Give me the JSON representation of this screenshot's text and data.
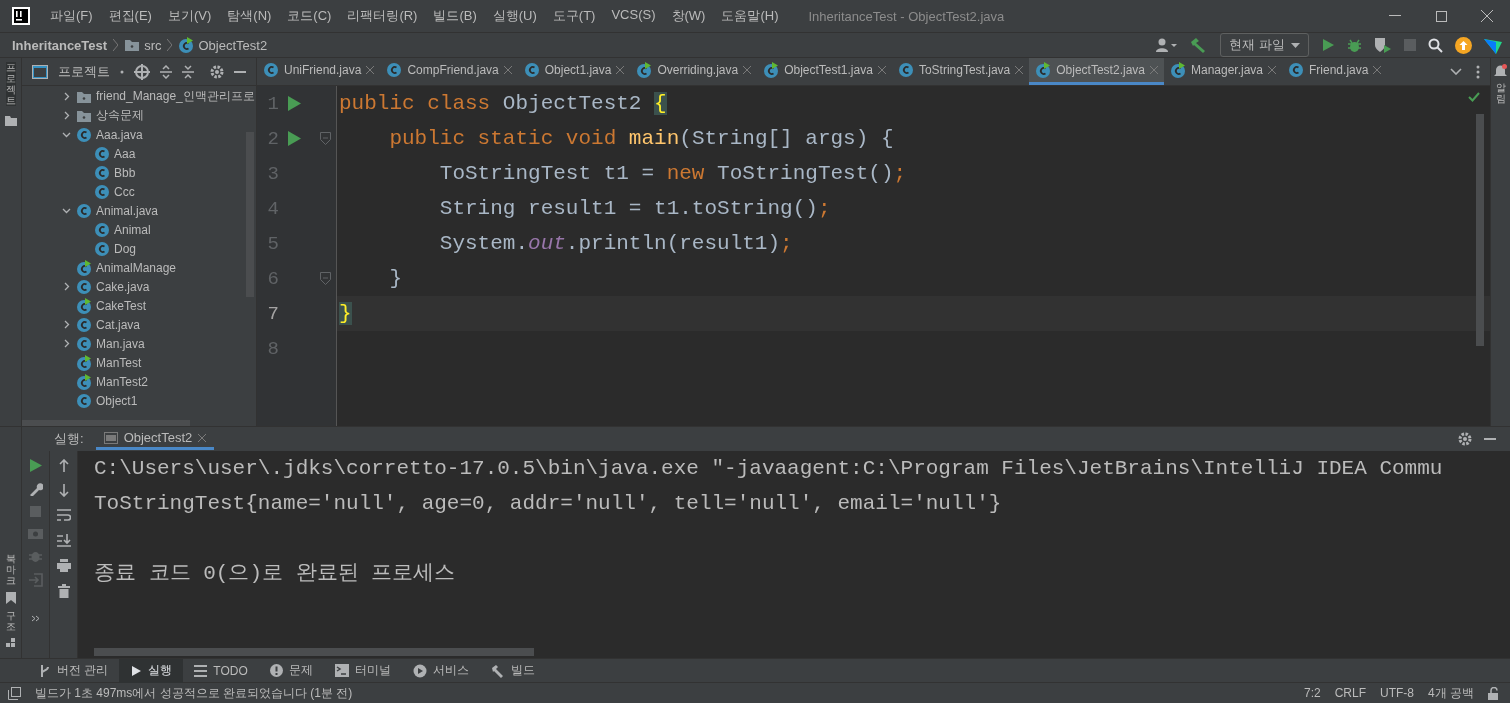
{
  "window": {
    "title": "InheritanceTest - ObjectTest2.java"
  },
  "menu": [
    "파일(F)",
    "편집(E)",
    "보기(V)",
    "탐색(N)",
    "코드(C)",
    "리팩터링(R)",
    "빌드(B)",
    "실행(U)",
    "도구(T)",
    "VCS(S)",
    "창(W)",
    "도움말(H)"
  ],
  "breadcrumbs": [
    {
      "label": "InheritanceTest",
      "kind": "project"
    },
    {
      "label": "src",
      "kind": "folder"
    },
    {
      "label": "ObjectTest2",
      "kind": "runnable"
    }
  ],
  "run_config": "현재 파일",
  "left_strip": [
    "프로젝트",
    "북마크",
    "구조"
  ],
  "right_strip": [
    "알림"
  ],
  "project_panel": {
    "title": "프로젝트",
    "tree": [
      {
        "label": "friend_Manage_인맥관리프로",
        "kind": "folder",
        "expanded": false
      },
      {
        "label": "상속문제",
        "kind": "folder",
        "expanded": false
      },
      {
        "label": "Aaa.java",
        "kind": "class",
        "expanded": true,
        "children": [
          {
            "label": "Aaa",
            "kind": "class"
          },
          {
            "label": "Bbb",
            "kind": "class"
          },
          {
            "label": "Ccc",
            "kind": "class"
          }
        ]
      },
      {
        "label": "Animal.java",
        "kind": "class",
        "expanded": true,
        "children": [
          {
            "label": "Animal",
            "kind": "class"
          },
          {
            "label": "Dog",
            "kind": "class"
          }
        ]
      },
      {
        "label": "AnimalManage",
        "kind": "runnable"
      },
      {
        "label": "Cake.java",
        "kind": "class",
        "expanded": false
      },
      {
        "label": "CakeTest",
        "kind": "runnable"
      },
      {
        "label": "Cat.java",
        "kind": "class",
        "expanded": false
      },
      {
        "label": "Man.java",
        "kind": "class",
        "expanded": false
      },
      {
        "label": "ManTest",
        "kind": "runnable"
      },
      {
        "label": "ManTest2",
        "kind": "runnable"
      },
      {
        "label": "Object1",
        "kind": "class"
      }
    ]
  },
  "tabs": [
    {
      "label": "UniFriend.java",
      "kind": "class",
      "selected": false
    },
    {
      "label": "CompFriend.java",
      "kind": "class",
      "selected": false
    },
    {
      "label": "Object1.java",
      "kind": "class",
      "selected": false
    },
    {
      "label": "Overriding.java",
      "kind": "runnable",
      "selected": false
    },
    {
      "label": "ObjectTest1.java",
      "kind": "runnable",
      "selected": false
    },
    {
      "label": "ToStringTest.java",
      "kind": "class",
      "selected": false
    },
    {
      "label": "ObjectTest2.java",
      "kind": "runnable",
      "selected": true
    },
    {
      "label": "Manager.java",
      "kind": "runnable",
      "selected": false
    },
    {
      "label": "Friend.java",
      "kind": "class",
      "selected": false
    }
  ],
  "code": [
    {
      "number": "1",
      "run": true,
      "fold": false,
      "current": false,
      "tokens": [
        {
          "kind": "keyword",
          "text": "public class "
        },
        {
          "kind": "plain",
          "text": "ObjectTest2 "
        },
        {
          "kind": "brace_match",
          "text": "{"
        }
      ]
    },
    {
      "number": "2",
      "run": true,
      "fold": true,
      "current": false,
      "tokens": [
        {
          "kind": "keyword",
          "text": "    public static void "
        },
        {
          "kind": "method",
          "text": "main"
        },
        {
          "kind": "plain",
          "text": "(String[] args) {"
        }
      ]
    },
    {
      "number": "3",
      "run": false,
      "fold": false,
      "current": false,
      "tokens": [
        {
          "kind": "plain",
          "text": "        ToStringTest t1 = "
        },
        {
          "kind": "keyword",
          "text": "new "
        },
        {
          "kind": "plain",
          "text": "ToStringTest()"
        },
        {
          "kind": "keyword",
          "text": ";"
        }
      ]
    },
    {
      "number": "4",
      "run": false,
      "fold": false,
      "current": false,
      "tokens": [
        {
          "kind": "plain",
          "text": "        String result1 = t1.toString()"
        },
        {
          "kind": "keyword",
          "text": ";"
        }
      ]
    },
    {
      "number": "5",
      "run": false,
      "fold": false,
      "current": false,
      "tokens": [
        {
          "kind": "plain",
          "text": "        System."
        },
        {
          "kind": "field",
          "text": "out"
        },
        {
          "kind": "plain",
          "text": ".println(result1)"
        },
        {
          "kind": "keyword",
          "text": ";"
        }
      ]
    },
    {
      "number": "6",
      "run": false,
      "fold": true,
      "current": false,
      "tokens": [
        {
          "kind": "plain",
          "text": "    }"
        }
      ]
    },
    {
      "number": "7",
      "run": false,
      "fold": false,
      "current": true,
      "tokens": [
        {
          "kind": "brace_match",
          "text": "}"
        }
      ]
    },
    {
      "number": "8",
      "run": false,
      "fold": false,
      "current": false
    }
  ],
  "run_panel": {
    "label": "실행:",
    "tab": "ObjectTest2",
    "output": [
      "C:\\Users\\user\\.jdks\\corretto-17.0.5\\bin\\java.exe \"-javaagent:C:\\Program Files\\JetBrains\\IntelliJ IDEA Commu",
      "ToStringTest{name='null', age=0, addr='null', tell='null', email='null'}",
      "종료 코드 0(으)로 완료된 프로세스"
    ]
  },
  "tool_tabs": [
    {
      "label": "버전 관리",
      "kind": "vcs",
      "selected": false
    },
    {
      "label": "실행",
      "kind": "run",
      "selected": true
    },
    {
      "label": "TODO",
      "kind": "todo",
      "selected": false
    },
    {
      "label": "문제",
      "kind": "problems",
      "selected": false
    },
    {
      "label": "터미널",
      "kind": "terminal",
      "selected": false
    },
    {
      "label": "서비스",
      "kind": "services",
      "selected": false
    },
    {
      "label": "빌드",
      "kind": "build",
      "selected": false
    }
  ],
  "status_bar": {
    "message": "빌드가 1초 497ms에서 성공적으로 완료되었습니다 (1분 전)",
    "position": "7:2",
    "line_separator": "CRLF",
    "encoding": "UTF-8",
    "indent": "4개 공백"
  }
}
